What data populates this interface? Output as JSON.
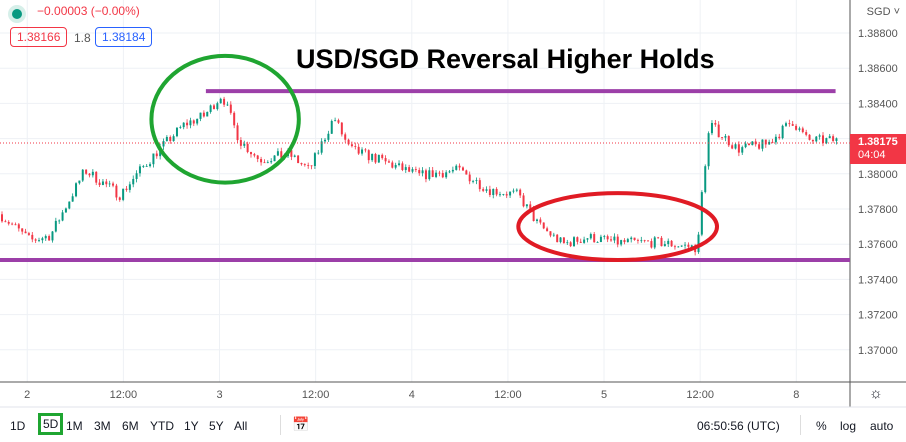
{
  "legend": {
    "change": "−0.00003 (−0.00%)",
    "bid": "1.38166",
    "spread": "1.8",
    "ask": "1.38184"
  },
  "currency": "SGD ˅",
  "price_tag": {
    "price": "1.38175",
    "countdown": "04:04"
  },
  "toolbar": {
    "ranges": [
      "1D",
      "5D",
      "1M",
      "3M",
      "6M",
      "YTD",
      "1Y",
      "5Y",
      "All"
    ],
    "selected": "5D",
    "time": "06:50:56 (UTC)",
    "percent": "%",
    "log": "log",
    "auto": "auto"
  },
  "colors": {
    "up": "#089981",
    "down": "#f23645",
    "line": "#9c3fa8",
    "green_circle": "#1fa531",
    "red_circle": "#e01b24"
  },
  "chart_data": {
    "type": "candlestick",
    "title": "USD/SGD Reversal Higher Holds",
    "ylim": [
      1.369,
      1.389
    ],
    "xlim": [
      -3.4,
      102.7
    ],
    "yticks": [
      1.388,
      1.386,
      1.384,
      1.382,
      1.38,
      1.378,
      1.376,
      1.374,
      1.372,
      1.37
    ],
    "ytick_labels": [
      "1.38800",
      "1.38600",
      "1.38400",
      "1.38200",
      "1.38000",
      "1.37800",
      "1.37600",
      "1.37400",
      "1.37200",
      "1.37000"
    ],
    "xticks": [
      0,
      12,
      24,
      36,
      48,
      60,
      72,
      84,
      96
    ],
    "xtick_labels": [
      "2",
      "12:00",
      "3",
      "12:00",
      "4",
      "12:00",
      "5",
      "12:00",
      "8"
    ],
    "close_path": [
      [
        -3.4,
        1.3777
      ],
      [
        0.4,
        1.3762
      ],
      [
        2.9,
        1.3765
      ],
      [
        7.2,
        1.3802
      ],
      [
        11.6,
        1.3788
      ],
      [
        14.1,
        1.3802
      ],
      [
        16.5,
        1.3814
      ],
      [
        19.6,
        1.3828
      ],
      [
        22.1,
        1.3833
      ],
      [
        24.3,
        1.3845
      ],
      [
        26.5,
        1.3819
      ],
      [
        29,
        1.3808
      ],
      [
        32.7,
        1.3811
      ],
      [
        35.2,
        1.3802
      ],
      [
        38.3,
        1.3832
      ],
      [
        40.2,
        1.3814
      ],
      [
        43.9,
        1.3808
      ],
      [
        48.9,
        1.3799
      ],
      [
        53.9,
        1.3802
      ],
      [
        57.6,
        1.3791
      ],
      [
        61.3,
        1.3788
      ],
      [
        63.8,
        1.3771
      ],
      [
        66.9,
        1.376
      ],
      [
        70,
        1.3764
      ],
      [
        73.7,
        1.3761
      ],
      [
        78.7,
        1.3761
      ],
      [
        83.7,
        1.3758
      ],
      [
        84.3,
        1.3794
      ],
      [
        85.2,
        1.3828
      ],
      [
        88.7,
        1.3814
      ],
      [
        92.4,
        1.3817
      ],
      [
        95.5,
        1.383
      ],
      [
        97.4,
        1.3819
      ],
      [
        101.1,
        1.3819
      ]
    ],
    "last_price": 1.38175,
    "annotations": {
      "resistance": {
        "price": 1.3847,
        "from": 22.3,
        "to": 100.9
      },
      "support": {
        "price": 1.3751,
        "from": -3.4,
        "to": 102.7
      },
      "green_circle": {
        "x": 24.7,
        "price": 1.3831,
        "rx_hours": 9.2,
        "ry_price": 0.0036
      },
      "red_circle": {
        "x": 73.7,
        "price": 1.377,
        "rx_hours": 12.4,
        "ry_price": 0.0019
      }
    }
  }
}
